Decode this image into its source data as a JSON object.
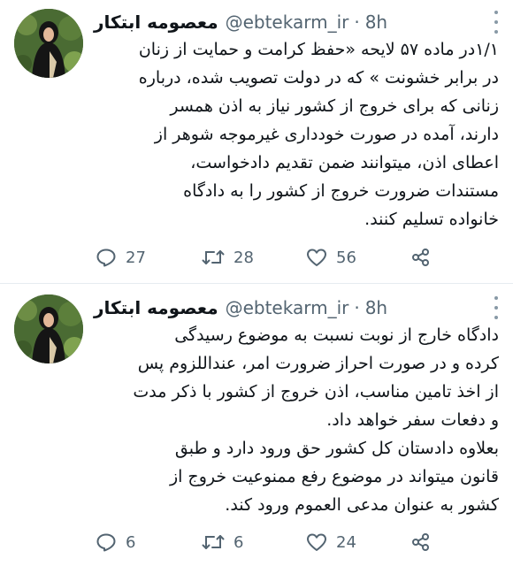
{
  "tweets": [
    {
      "name": "معصومه ابتکار",
      "handle": "@ebtekarm_ir",
      "time": "8h",
      "lines": [
        "۱/۱در ماده ۵۷ لایحه «حفظ کرامت و حمایت از زنان",
        "در برابر خشونت » که در دولت تصویب شده، درباره",
        "زنانی که برای خروج از کشور نیاز به اذن همسر",
        "دارند، آمده در صورت خودداری غیرموجه شوهر از",
        "اعطای اذن، میتوانند ضمن تقدیم دادخواست،",
        "مستندات ضرورت خروج از کشور را به دادگاه",
        "خانواده تسلیم کنند."
      ],
      "replies": "27",
      "retweets": "28",
      "likes": "56"
    },
    {
      "name": "معصومه ابتکار",
      "handle": "@ebtekarm_ir",
      "time": "8h",
      "lines": [
        "دادگاه خارج از نوبت نسبت به موضوع رسیدگی",
        "کرده و در صورت احراز ضرورت امر، عنداللزوم پس",
        "از اخذ تامین مناسب، اذن خروج از کشور با ذکر مدت",
        "و دفعات سفر خواهد داد.",
        "بعلاوه دادستان کل کشور حق ورود دارد و طبق",
        "قانون میتواند در موضوع رفع ممنوعیت خروج از",
        "کشور به عنوان مدعی العموم ورود کند."
      ],
      "replies": "6",
      "retweets": "6",
      "likes": "24"
    }
  ],
  "separator": "·",
  "icons": {
    "reply": "reply-icon",
    "retweet": "retweet-icon",
    "like": "heart-icon",
    "share": "share-icon",
    "more": "more-dots-icon"
  },
  "colors": {
    "text": "#0f1419",
    "secondary": "#536471",
    "border": "#e6ecf0"
  }
}
